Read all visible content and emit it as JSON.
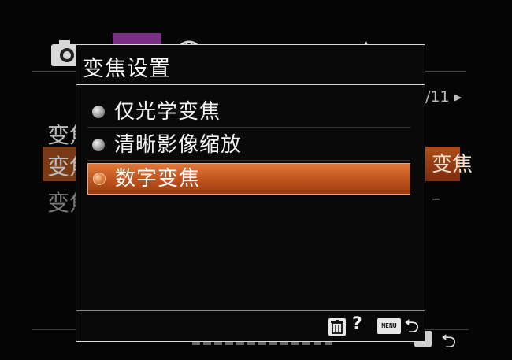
{
  "background": {
    "page_indicator": "/11 ▸",
    "items": [
      {
        "label": "变焦"
      },
      {
        "label": "变焦"
      },
      {
        "label": "变焦"
      }
    ],
    "selected_value": "变焦",
    "dimmed_value": "–"
  },
  "dialog": {
    "title": "变焦设置",
    "options": [
      {
        "label": "仅光学变焦",
        "selected": false
      },
      {
        "label": "清晰影像缩放",
        "selected": false
      },
      {
        "label": "数字变焦",
        "selected": true
      }
    ],
    "footer": {
      "help": "?",
      "menu_key": "MENU",
      "back": "⮌"
    }
  },
  "icons": {
    "tabs": [
      "camera-icon",
      "camera2-icon",
      "globe-icon",
      "playback-icon",
      "toolbox-icon",
      "star-icon"
    ],
    "footer": [
      "trash-icon",
      "help-icon",
      "menu-key-icon",
      "back-icon"
    ]
  },
  "colors": {
    "highlight": "#c1561f",
    "tab_active": "#7b2f86",
    "border": "#dcdcdc"
  }
}
